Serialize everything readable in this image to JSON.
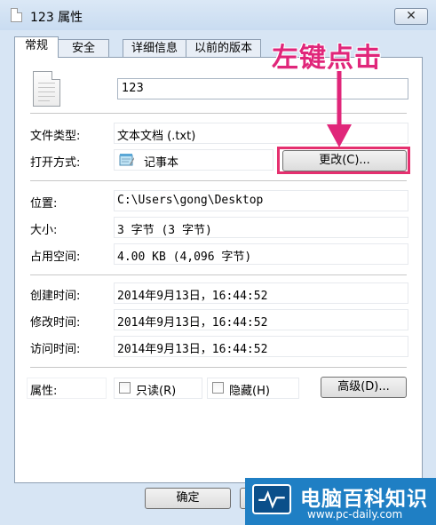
{
  "window": {
    "title": "123 属性",
    "close_label": "✕"
  },
  "tabs": [
    {
      "label": "常规"
    },
    {
      "label": "安全"
    },
    {
      "label": "详细信息"
    },
    {
      "label": "以前的版本"
    }
  ],
  "general": {
    "file_name": "123",
    "file_type_label": "文件类型:",
    "file_type_value": "文本文档 (.txt)",
    "opens_with_label": "打开方式:",
    "opens_with_value": "记事本",
    "change_button": "更改(C)...",
    "location_label": "位置:",
    "location_value": "C:\\Users\\gong\\Desktop",
    "size_label": "大小:",
    "size_value": "3 字节 (3 字节)",
    "size_on_disk_label": "占用空间:",
    "size_on_disk_value": "4.00 KB (4,096 字节)",
    "created_label": "创建时间:",
    "created_value": "2014年9月13日，16:44:52",
    "modified_label": "修改时间:",
    "modified_value": "2014年9月13日，16:44:52",
    "accessed_label": "访问时间:",
    "accessed_value": "2014年9月13日，16:44:52",
    "attributes_label": "属性:",
    "readonly_label": "只读(R)",
    "hidden_label": "隐藏(H)",
    "advanced_button": "高级(D)..."
  },
  "footer": {
    "ok_button": "确定"
  },
  "annotation": {
    "text": "左键点击",
    "color": "#e0267a"
  },
  "watermark": {
    "name": "电脑百科知识",
    "url": "www.pc-daily.com"
  }
}
